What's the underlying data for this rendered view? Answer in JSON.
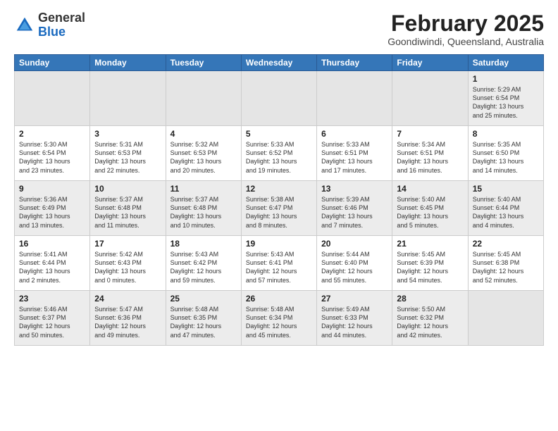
{
  "logo": {
    "general": "General",
    "blue": "Blue"
  },
  "title": "February 2025",
  "location": "Goondiwindi, Queensland, Australia",
  "days_of_week": [
    "Sunday",
    "Monday",
    "Tuesday",
    "Wednesday",
    "Thursday",
    "Friday",
    "Saturday"
  ],
  "weeks": [
    [
      {
        "day": "",
        "info": ""
      },
      {
        "day": "",
        "info": ""
      },
      {
        "day": "",
        "info": ""
      },
      {
        "day": "",
        "info": ""
      },
      {
        "day": "",
        "info": ""
      },
      {
        "day": "",
        "info": ""
      },
      {
        "day": "1",
        "info": "Sunrise: 5:29 AM\nSunset: 6:54 PM\nDaylight: 13 hours\nand 25 minutes."
      }
    ],
    [
      {
        "day": "2",
        "info": "Sunrise: 5:30 AM\nSunset: 6:54 PM\nDaylight: 13 hours\nand 23 minutes."
      },
      {
        "day": "3",
        "info": "Sunrise: 5:31 AM\nSunset: 6:53 PM\nDaylight: 13 hours\nand 22 minutes."
      },
      {
        "day": "4",
        "info": "Sunrise: 5:32 AM\nSunset: 6:53 PM\nDaylight: 13 hours\nand 20 minutes."
      },
      {
        "day": "5",
        "info": "Sunrise: 5:33 AM\nSunset: 6:52 PM\nDaylight: 13 hours\nand 19 minutes."
      },
      {
        "day": "6",
        "info": "Sunrise: 5:33 AM\nSunset: 6:51 PM\nDaylight: 13 hours\nand 17 minutes."
      },
      {
        "day": "7",
        "info": "Sunrise: 5:34 AM\nSunset: 6:51 PM\nDaylight: 13 hours\nand 16 minutes."
      },
      {
        "day": "8",
        "info": "Sunrise: 5:35 AM\nSunset: 6:50 PM\nDaylight: 13 hours\nand 14 minutes."
      }
    ],
    [
      {
        "day": "9",
        "info": "Sunrise: 5:36 AM\nSunset: 6:49 PM\nDaylight: 13 hours\nand 13 minutes."
      },
      {
        "day": "10",
        "info": "Sunrise: 5:37 AM\nSunset: 6:48 PM\nDaylight: 13 hours\nand 11 minutes."
      },
      {
        "day": "11",
        "info": "Sunrise: 5:37 AM\nSunset: 6:48 PM\nDaylight: 13 hours\nand 10 minutes."
      },
      {
        "day": "12",
        "info": "Sunrise: 5:38 AM\nSunset: 6:47 PM\nDaylight: 13 hours\nand 8 minutes."
      },
      {
        "day": "13",
        "info": "Sunrise: 5:39 AM\nSunset: 6:46 PM\nDaylight: 13 hours\nand 7 minutes."
      },
      {
        "day": "14",
        "info": "Sunrise: 5:40 AM\nSunset: 6:45 PM\nDaylight: 13 hours\nand 5 minutes."
      },
      {
        "day": "15",
        "info": "Sunrise: 5:40 AM\nSunset: 6:44 PM\nDaylight: 13 hours\nand 4 minutes."
      }
    ],
    [
      {
        "day": "16",
        "info": "Sunrise: 5:41 AM\nSunset: 6:44 PM\nDaylight: 13 hours\nand 2 minutes."
      },
      {
        "day": "17",
        "info": "Sunrise: 5:42 AM\nSunset: 6:43 PM\nDaylight: 13 hours\nand 0 minutes."
      },
      {
        "day": "18",
        "info": "Sunrise: 5:43 AM\nSunset: 6:42 PM\nDaylight: 12 hours\nand 59 minutes."
      },
      {
        "day": "19",
        "info": "Sunrise: 5:43 AM\nSunset: 6:41 PM\nDaylight: 12 hours\nand 57 minutes."
      },
      {
        "day": "20",
        "info": "Sunrise: 5:44 AM\nSunset: 6:40 PM\nDaylight: 12 hours\nand 55 minutes."
      },
      {
        "day": "21",
        "info": "Sunrise: 5:45 AM\nSunset: 6:39 PM\nDaylight: 12 hours\nand 54 minutes."
      },
      {
        "day": "22",
        "info": "Sunrise: 5:45 AM\nSunset: 6:38 PM\nDaylight: 12 hours\nand 52 minutes."
      }
    ],
    [
      {
        "day": "23",
        "info": "Sunrise: 5:46 AM\nSunset: 6:37 PM\nDaylight: 12 hours\nand 50 minutes."
      },
      {
        "day": "24",
        "info": "Sunrise: 5:47 AM\nSunset: 6:36 PM\nDaylight: 12 hours\nand 49 minutes."
      },
      {
        "day": "25",
        "info": "Sunrise: 5:48 AM\nSunset: 6:35 PM\nDaylight: 12 hours\nand 47 minutes."
      },
      {
        "day": "26",
        "info": "Sunrise: 5:48 AM\nSunset: 6:34 PM\nDaylight: 12 hours\nand 45 minutes."
      },
      {
        "day": "27",
        "info": "Sunrise: 5:49 AM\nSunset: 6:33 PM\nDaylight: 12 hours\nand 44 minutes."
      },
      {
        "day": "28",
        "info": "Sunrise: 5:50 AM\nSunset: 6:32 PM\nDaylight: 12 hours\nand 42 minutes."
      },
      {
        "day": "",
        "info": ""
      }
    ]
  ]
}
